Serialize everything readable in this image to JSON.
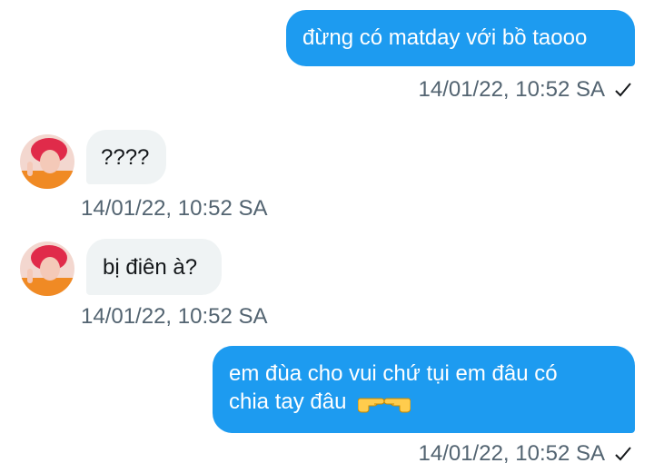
{
  "messages": [
    {
      "direction": "outgoing",
      "text": "đừng có matday với bồ taooo",
      "time": "14/01/22, 10:52 SA",
      "status_icon": "check-icon"
    },
    {
      "direction": "incoming",
      "text": "????",
      "time": "14/01/22, 10:52 SA",
      "avatar_icon": "avatar-red-hair"
    },
    {
      "direction": "incoming",
      "text": "bị điên à?",
      "time": "14/01/22, 10:52 SA",
      "avatar_icon": "avatar-red-hair"
    },
    {
      "direction": "outgoing",
      "text_line1": "em đùa cho vui chứ tụi em đâu có",
      "text_line2": "chia tay đâu",
      "emoji": "point-right-point-left-emoji",
      "time": "14/01/22, 10:52 SA",
      "status_icon": "check-icon"
    }
  ],
  "colors": {
    "outgoing_bubble": "#1d9bf0",
    "incoming_bubble": "#eff3f4",
    "timestamp": "#536471"
  }
}
